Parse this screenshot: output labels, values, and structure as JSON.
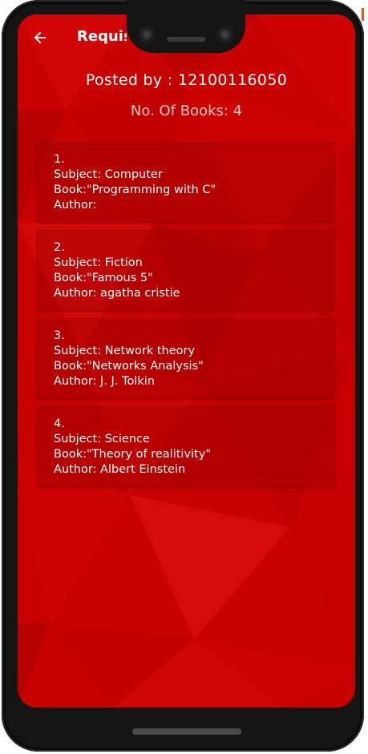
{
  "app": {
    "title": "Requisi",
    "back_icon": "arrow-left-icon"
  },
  "header": {
    "posted_by": "Posted by : 12100116050",
    "book_count": "No. Of Books: 4"
  },
  "books": [
    {
      "index": "1.",
      "subject": "Subject: Computer",
      "book": "Book:\"Programming with C\"",
      "author": "Author:"
    },
    {
      "index": "2.",
      "subject": "Subject: Fiction",
      "book": "Book:\"Famous 5\"",
      "author": "Author: agatha cristie"
    },
    {
      "index": "3.",
      "subject": "Subject: Network theory",
      "book": "Book:\"Networks Analysis\"",
      "author": "Author: J. J. Tolkin"
    },
    {
      "index": "4.",
      "subject": "Subject: Science",
      "book": "Book:\"Theory of realitivity\"",
      "author": "Author: Albert Einstein"
    }
  ],
  "colors": {
    "background": "#c80000",
    "text": "#ffffff",
    "count_text": "#f3c9c9"
  }
}
